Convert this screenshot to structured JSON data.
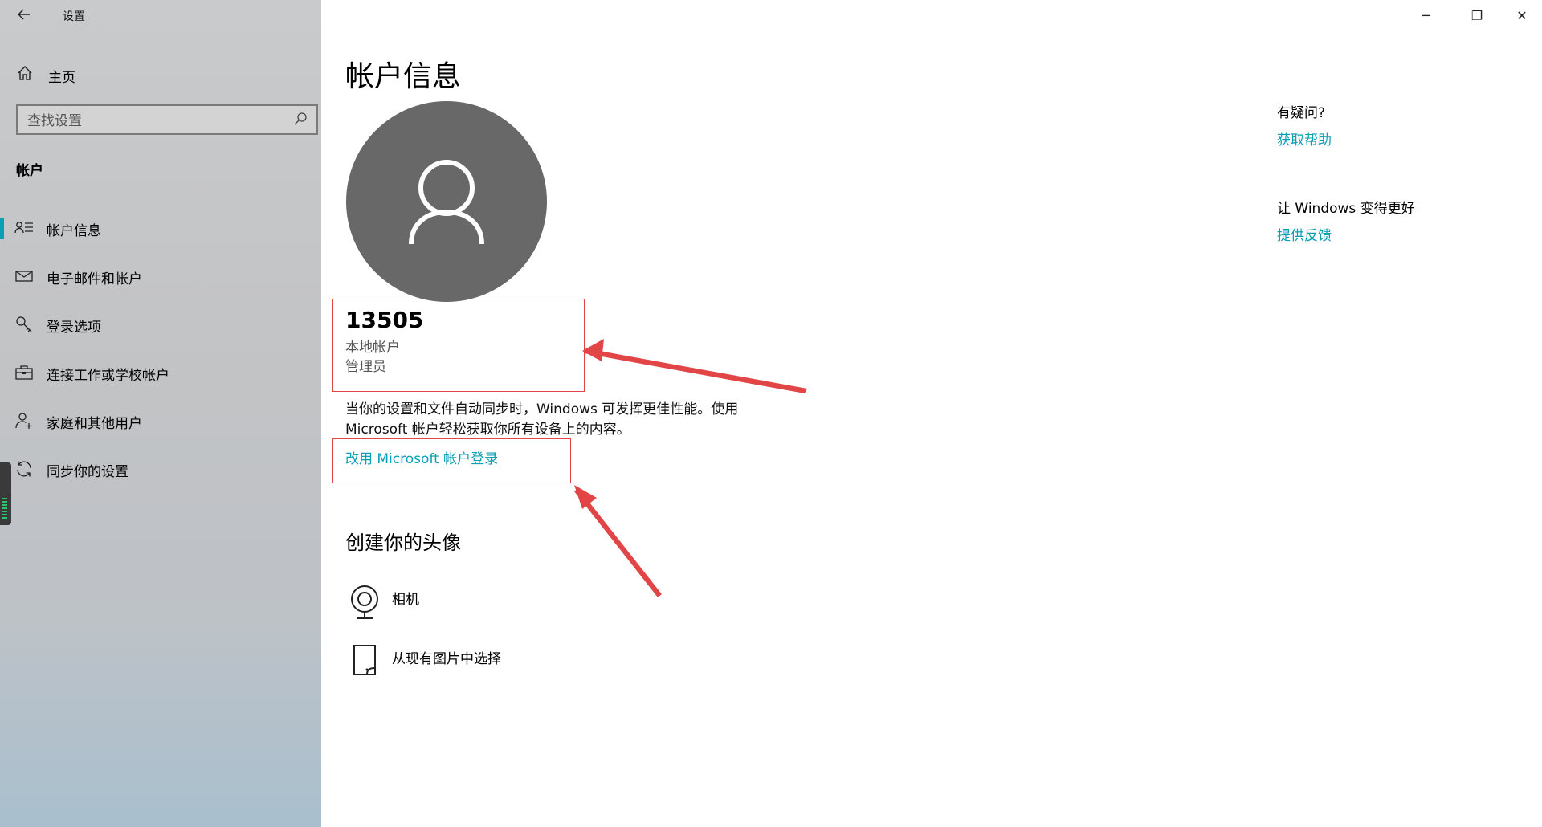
{
  "app": {
    "title": "设置"
  },
  "window_controls": {
    "minimize": "─",
    "restore": "❐",
    "close": "✕"
  },
  "sidebar": {
    "home_label": "主页",
    "search_placeholder": "查找设置",
    "section_title": "帐户",
    "items": [
      {
        "label": "帐户信息",
        "icon": "account-info-icon",
        "active": true
      },
      {
        "label": "电子邮件和帐户",
        "icon": "mail-icon",
        "active": false
      },
      {
        "label": "登录选项",
        "icon": "key-icon",
        "active": false
      },
      {
        "label": "连接工作或学校帐户",
        "icon": "briefcase-icon",
        "active": false
      },
      {
        "label": "家庭和其他用户",
        "icon": "add-person-icon",
        "active": false
      },
      {
        "label": "同步你的设置",
        "icon": "sync-icon",
        "active": false
      }
    ]
  },
  "main": {
    "page_title": "帐户信息",
    "user": {
      "name": "13505",
      "account_type": "本地帐户",
      "role": "管理员"
    },
    "description": "当你的设置和文件自动同步时，Windows 可发挥更佳性能。使用 Microsoft 帐户轻松获取你所有设备上的内容。",
    "ms_signin_link": "改用 Microsoft 帐户登录",
    "create_avatar_title": "创建你的头像",
    "avatar_options": [
      {
        "label": "相机",
        "icon": "camera-icon"
      },
      {
        "label": "从现有图片中选择",
        "icon": "browse-picture-icon"
      }
    ]
  },
  "help": {
    "question_title": "有疑问?",
    "get_help_link": "获取帮助",
    "feedback_title": "让 Windows 变得更好",
    "feedback_link": "提供反馈"
  },
  "colors": {
    "accent": "#0a9fb5",
    "annotation_red": "#e24545",
    "avatar_bg": "#686868"
  }
}
